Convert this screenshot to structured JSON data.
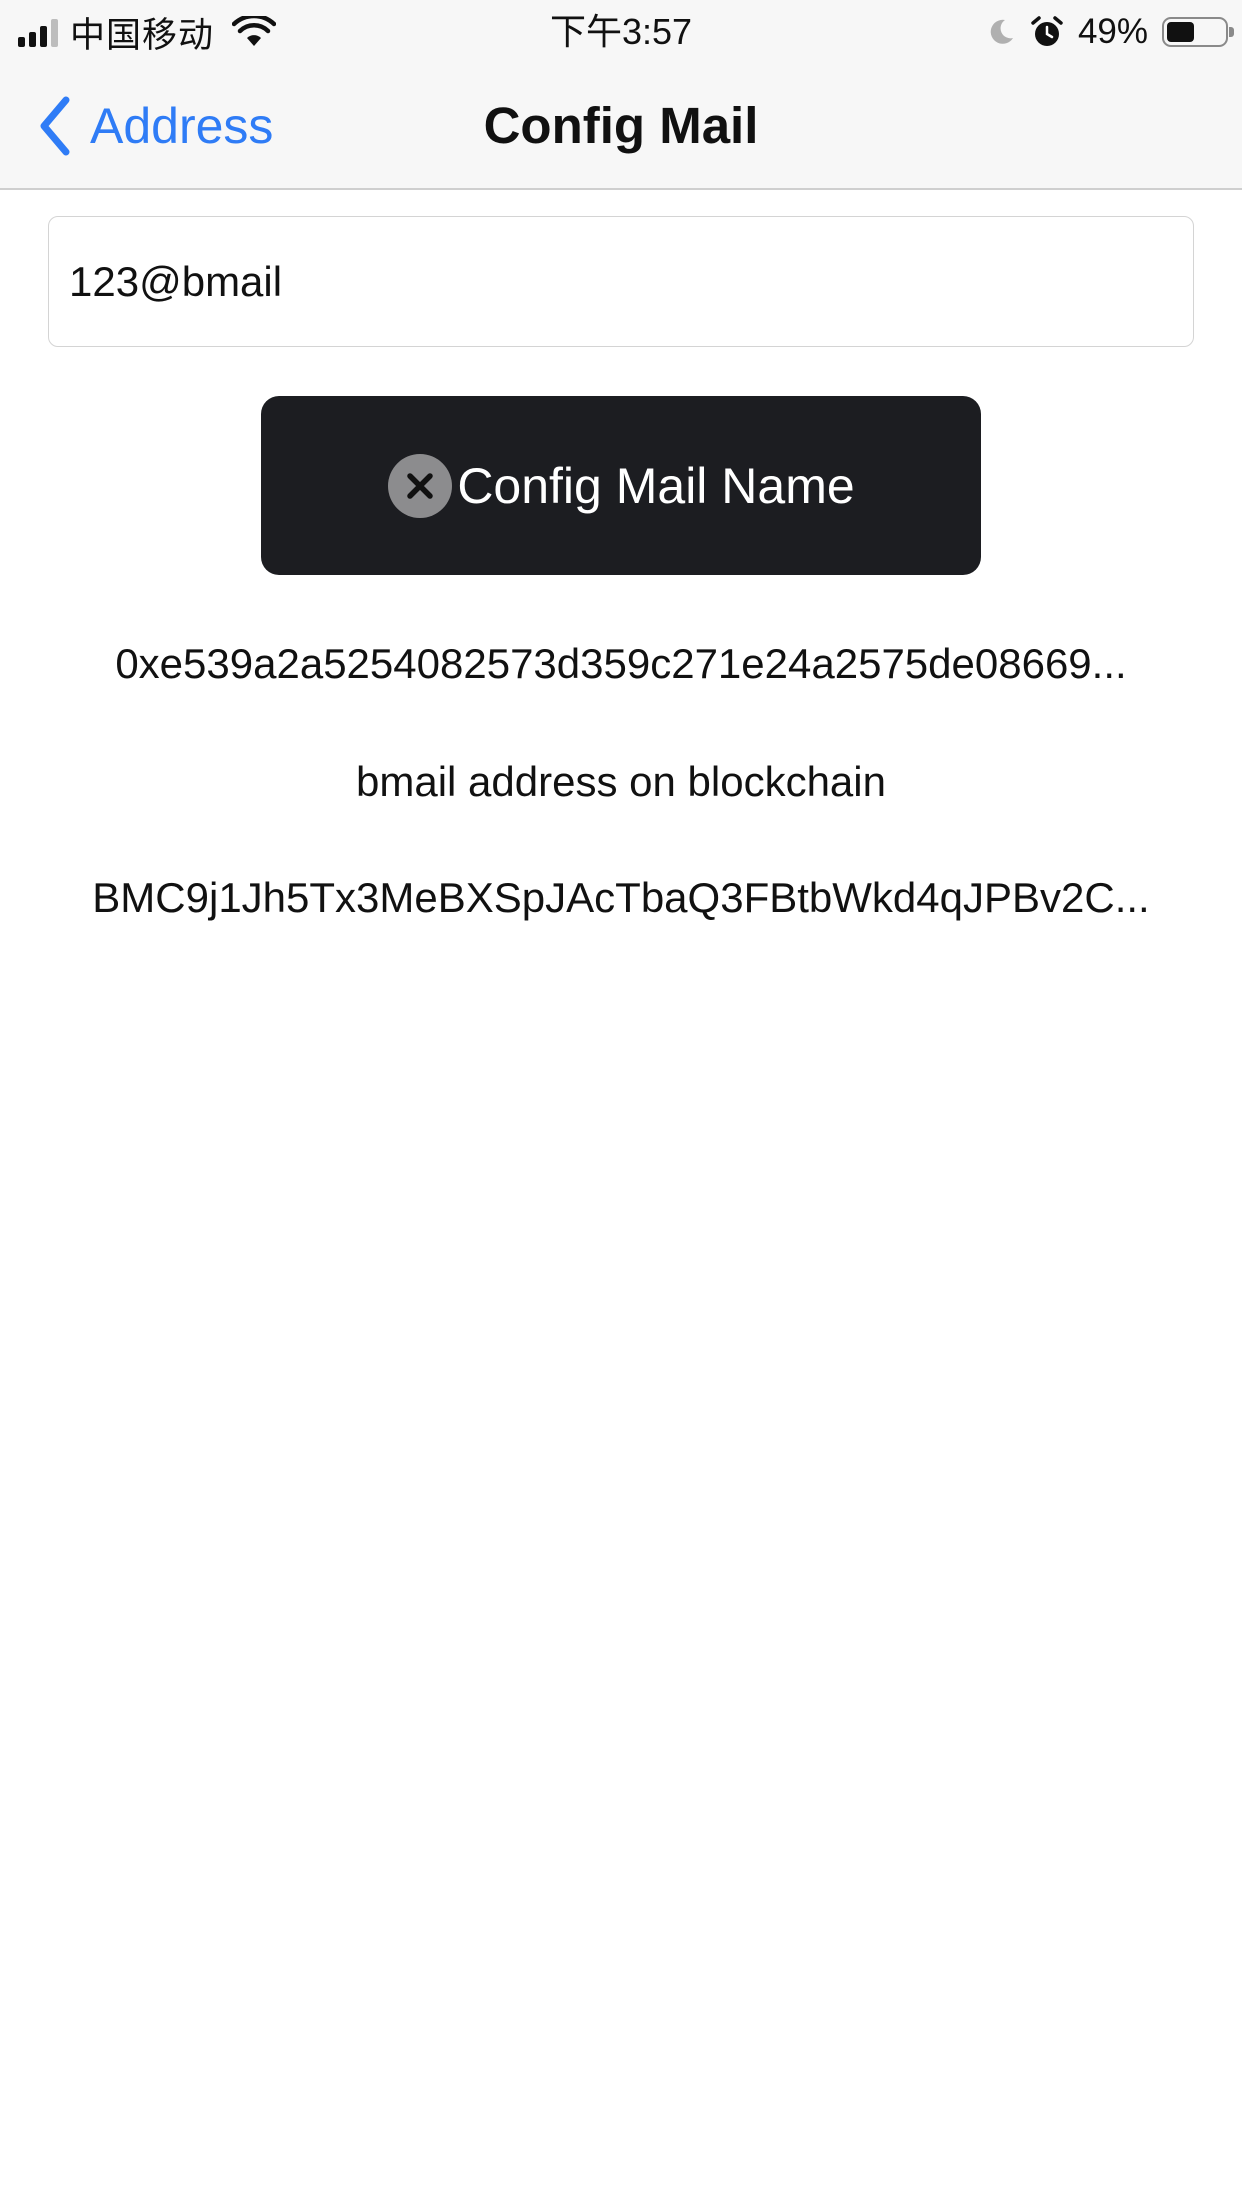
{
  "status_bar": {
    "carrier": "中国移动",
    "time": "下午3:57",
    "battery_percent": "49%",
    "battery_level": 0.49,
    "signal_bars": 3,
    "icons": [
      "signal-icon",
      "wifi-icon",
      "moon-icon",
      "alarm-icon",
      "battery-icon"
    ]
  },
  "nav": {
    "back_label": "Address",
    "back_icon": "chevron-left-icon",
    "title": "Config Mail"
  },
  "form": {
    "mail_name_value": "123@bmail"
  },
  "toast": {
    "icon": "close-circle-icon",
    "message": "Config Mail Name"
  },
  "content": {
    "eth_address": "0xe539a2a5254082573d359c271e24a2575de08669...",
    "caption": "bmail address on blockchain",
    "bmail_address": "BMC9j1Jh5Tx3MeBXSpJAcTbaQ3FBtbWkd4qJPBv2C..."
  },
  "colors": {
    "accent": "#2f7cf6",
    "toast_background": "#1c1d21",
    "bar_background": "#f7f7f7"
  }
}
